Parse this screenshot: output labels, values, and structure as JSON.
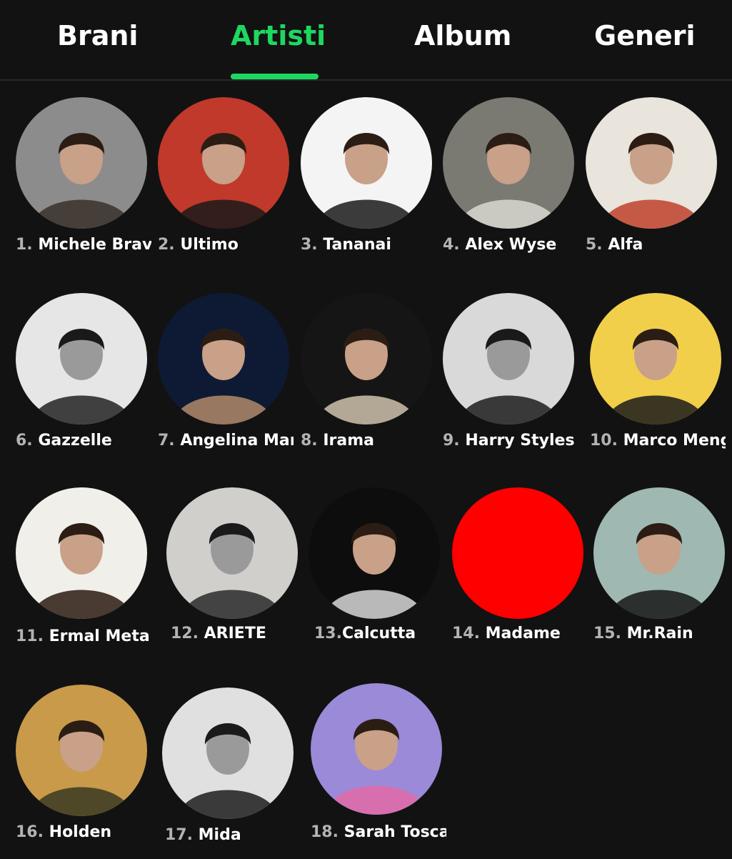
{
  "tabs": [
    {
      "label": "Brani",
      "active": false
    },
    {
      "label": "Artisti",
      "active": true
    },
    {
      "label": "Album",
      "active": false
    },
    {
      "label": "Generi",
      "active": false
    }
  ],
  "accent_color": "#1ed760",
  "artists": [
    {
      "rank": "1.",
      "name": "Michele Bravi",
      "bg": "#8c8c8c",
      "fg": "#3a302a",
      "mode": "color"
    },
    {
      "rank": "2.",
      "name": "Ultimo",
      "bg": "#c0392b",
      "fg": "#1a1a1a",
      "mode": "color"
    },
    {
      "rank": "3.",
      "name": "Tananai",
      "bg": "#f4f4f4",
      "fg": "#1a1a1a",
      "mode": "color"
    },
    {
      "rank": "4.",
      "name": "Alex Wyse",
      "bg": "#7a7a72",
      "fg": "#d8d8d0",
      "mode": "color"
    },
    {
      "rank": "5.",
      "name": "Alfa",
      "bg": "#e9e4dc",
      "fg": "#c0412b",
      "mode": "color"
    },
    {
      "rank": "6.",
      "name": "Gazzelle",
      "bg": "#e6e6e6",
      "fg": "#222222",
      "mode": "bw"
    },
    {
      "rank": "7.",
      "name": "Angelina Mango",
      "bg": "#0e1a33",
      "fg": "#b08a6a",
      "mode": "color"
    },
    {
      "rank": "8.",
      "name": "Irama",
      "bg": "#151515",
      "fg": "#cfc2ad",
      "mode": "color"
    },
    {
      "rank": "9.",
      "name": "Harry Styles",
      "bg": "#d9d9d9",
      "fg": "#1c1c1c",
      "mode": "bw"
    },
    {
      "rank": "10.",
      "name": "Marco Mengoni",
      "bg": "#f2cf4a",
      "fg": "#1b1b1b",
      "mode": "color"
    },
    {
      "rank": "11.",
      "name": "Ermal Meta",
      "bg": "#f1efe9",
      "fg": "#2b1a12",
      "mode": "color"
    },
    {
      "rank": "12.",
      "name": "ARIETE",
      "bg": "#d0cfcc",
      "fg": "#2a2a2a",
      "mode": "bw"
    },
    {
      "rank": "13.",
      "name": "Calcutta",
      "bg": "#0d0d0d",
      "fg": "#d8d8d8",
      "mode": "color"
    },
    {
      "rank": "14.",
      "name": "Madame",
      "bg": "#ff0000",
      "fg": "#ff0000",
      "mode": "solid"
    },
    {
      "rank": "15.",
      "name": "Mr.Rain",
      "bg": "#9fb8b2",
      "fg": "#161616",
      "mode": "color"
    },
    {
      "rank": "16.",
      "name": "Holden",
      "bg": "#c89a4a",
      "fg": "#3a3a22",
      "mode": "color"
    },
    {
      "rank": "17.",
      "name": "Mida",
      "bg": "#e0e0e0",
      "fg": "#1c1c1c",
      "mode": "bw"
    },
    {
      "rank": "18.",
      "name": "Sarah Toscano",
      "bg": "#9b8ad8",
      "fg": "#e26aa8",
      "mode": "color"
    }
  ]
}
